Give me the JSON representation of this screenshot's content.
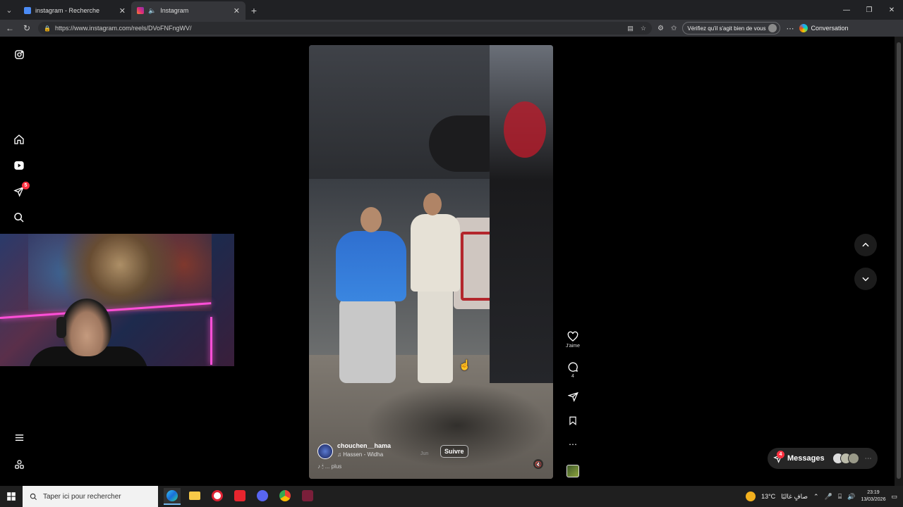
{
  "browser": {
    "tabs": [
      {
        "title": "instagram - Recherche",
        "active": false
      },
      {
        "title": "Instagram",
        "active": true
      }
    ],
    "url": "https://www.instagram.com/reels/DVoFNFngWV/",
    "verify_label": "Vérifiez qu'il s'agit bien de vous",
    "conversation_label": "Conversation"
  },
  "sidebar": {
    "items": [
      "instagram-logo",
      "home",
      "reels",
      "messages",
      "search",
      "more",
      "meta"
    ],
    "notification_count": "5"
  },
  "reel": {
    "username": "chouchen__hama",
    "music": "Hassen - Widha",
    "caption_more": "... plus",
    "caption_faded": "Jun",
    "follow_label": "Suivre",
    "like_label": "J'aime",
    "comment_count": "4"
  },
  "messages": {
    "label": "Messages",
    "badge": "4"
  },
  "taskbar": {
    "search_placeholder": "Taper ici pour rechercher",
    "weather": "13°C",
    "weather_text": "صافٍ غالبًا",
    "time": "23:19",
    "date": "13/03/2026"
  },
  "colors": {
    "accent_badge": "#ff3040",
    "page_bg": "#000000",
    "pill_bg": "#262626"
  }
}
